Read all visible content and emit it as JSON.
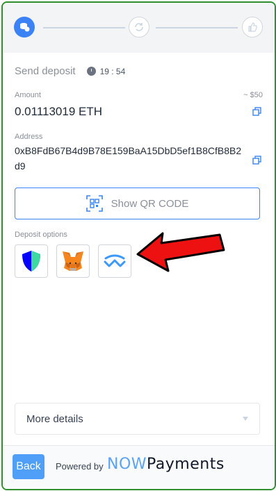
{
  "stepper": {
    "steps": [
      "send-icon",
      "exchange-icon",
      "done-icon"
    ],
    "active_color": "#3b82f6"
  },
  "header": {
    "title": "Send deposit",
    "timer": "19 : 54"
  },
  "amount": {
    "label": "Amount",
    "usd": "~ $50",
    "value": "0.01113019 ETH"
  },
  "address": {
    "label": "Address",
    "value": "0xB8FdB67B4d9B78E159BaA15DbD5ef1B8CfB8B2d9"
  },
  "qr_button": {
    "label": "Show QR CODE"
  },
  "deposit_options": {
    "label": "Deposit options",
    "items": [
      "trust-wallet-icon",
      "metamask-icon",
      "walletconnect-icon"
    ]
  },
  "more_details": {
    "label": "More details"
  },
  "footer": {
    "back_label": "Back",
    "powered_by": "Powered by",
    "brand_now": "NOW",
    "brand_payments": "Payments"
  }
}
